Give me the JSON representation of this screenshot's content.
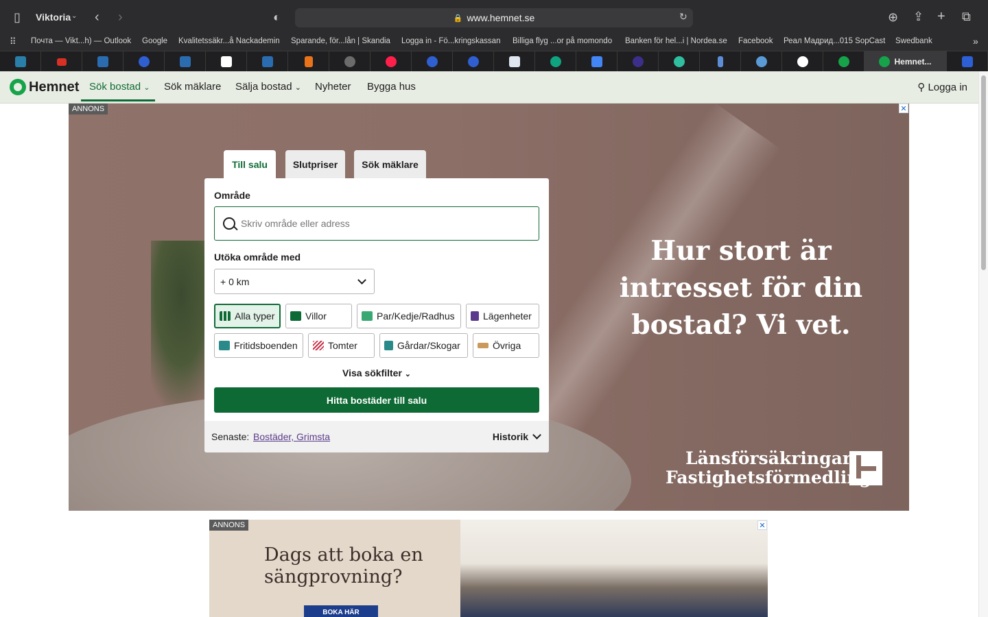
{
  "browser": {
    "profile": "Viktoria",
    "url": "www.hemnet.se",
    "favorites": [
      "Почта — Vikt...h) — Outlook",
      "Google",
      "Kvalitetssäkr...å Nackademin",
      "Sparande, för...lån | Skandia",
      "Logga in - Fö...kringskassan",
      "Billiga flyg ...or på momondo",
      "Banken för hel...i | Nordea.se",
      "Facebook",
      "Реал Мадрид...015 SopCast",
      "Swedbank"
    ],
    "active_tab": "Hemnet..."
  },
  "site": {
    "logo": "Hemnet",
    "nav": [
      "Sök bostad",
      "Sök mäklare",
      "Sälja bostad",
      "Nyheter",
      "Bygga hus"
    ],
    "login": "Logga in"
  },
  "ad_label": "ANNONS",
  "hero_ad": {
    "headline": "Hur stort är intresset för din bostad? Vi vet.",
    "brand_line1": "Länsförsäkringar",
    "brand_line2": "Fastighetsförmedling"
  },
  "search": {
    "tabs": [
      "Till salu",
      "Slutpriser",
      "Sök mäklare"
    ],
    "area_label": "Område",
    "area_placeholder": "Skriv område eller adress",
    "expand_label": "Utöka område med",
    "expand_value": "+ 0 km",
    "types": [
      "Alla typer",
      "Villor",
      "Par/Kedje/Radhus",
      "Lägenheter",
      "Fritidsboenden",
      "Tomter",
      "Gårdar/Skogar",
      "Övriga"
    ],
    "show_filters": "Visa sökfilter",
    "cta": "Hitta bostäder till salu",
    "recent_label": "Senaste:",
    "recent_value": "Bostäder, Grimsta",
    "history": "Historik"
  },
  "ad2": {
    "headline_line1": "Dags att boka en",
    "headline_line2": "sängprovning?",
    "button": "BOKA HÄR"
  }
}
